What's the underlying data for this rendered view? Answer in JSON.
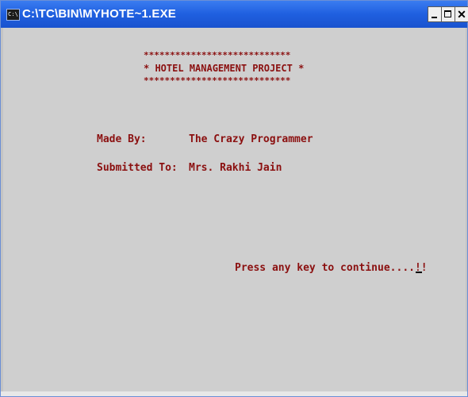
{
  "window": {
    "title": "C:\\TC\\BIN\\MYHOTE~1.EXE",
    "icon_text": "C:\\"
  },
  "console": {
    "stars_top": "****************************",
    "heading": "* HOTEL MANAGEMENT PROJECT *",
    "stars_bottom": "****************************",
    "made_by_label": "Made By:",
    "made_by_value": "The Crazy Programmer",
    "submitted_to_label": "Submitted To:",
    "submitted_to_value": "Mrs. Rakhi Jain",
    "prompt": "Press any key to continue....!!"
  },
  "colors": {
    "titlebar": "#1f5fe0",
    "console_bg": "#cfcfcf",
    "text": "#8b1010"
  }
}
